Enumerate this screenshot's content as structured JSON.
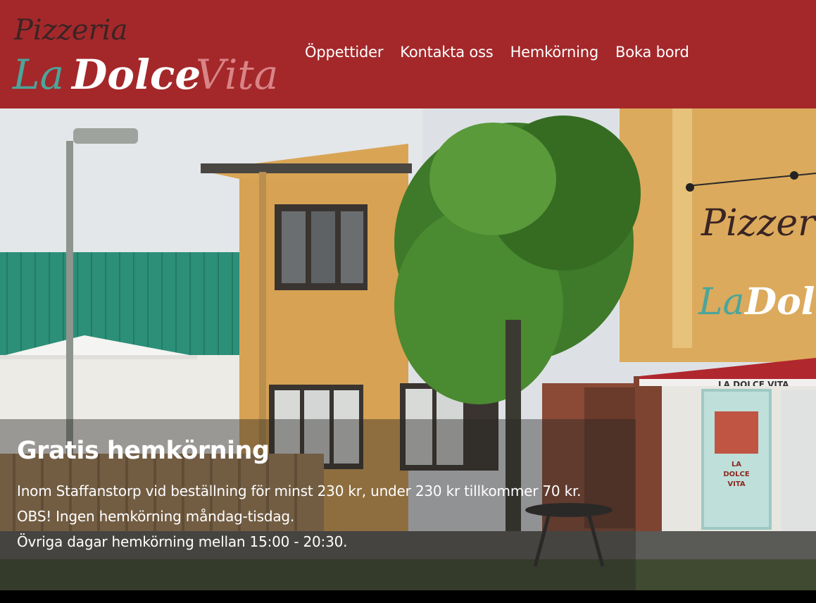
{
  "brand": {
    "line1": "Pizzeria",
    "line2_a": "La",
    "line2_b": "Dolce",
    "line2_c": "Vita",
    "colors": {
      "header_bg": "#a4282a",
      "teal": "#4ba59b",
      "pink": "#d98487",
      "dark": "#3a2a2a"
    }
  },
  "nav": {
    "items": [
      "Öppettider",
      "Kontakta oss",
      "Hemkörning",
      "Boka bord"
    ]
  },
  "hero": {
    "sign_line1": "Pizzeria",
    "sign_la": "La",
    "sign_dolce": "Dolce",
    "awning_text": "LA DOLCE VITA",
    "poster_text": [
      "LA",
      "DOLCE",
      "VITA"
    ],
    "caption": {
      "title": "Gratis hemkörning",
      "lines": [
        "Inom Staffanstorp vid beställning för minst 230 kr, under 230 kr tillkommer 70 kr.",
        "OBS! Ingen hemkörning måndag-tisdag.",
        "Övriga dagar hemkörning mellan 15:00 - 20:30."
      ]
    }
  }
}
